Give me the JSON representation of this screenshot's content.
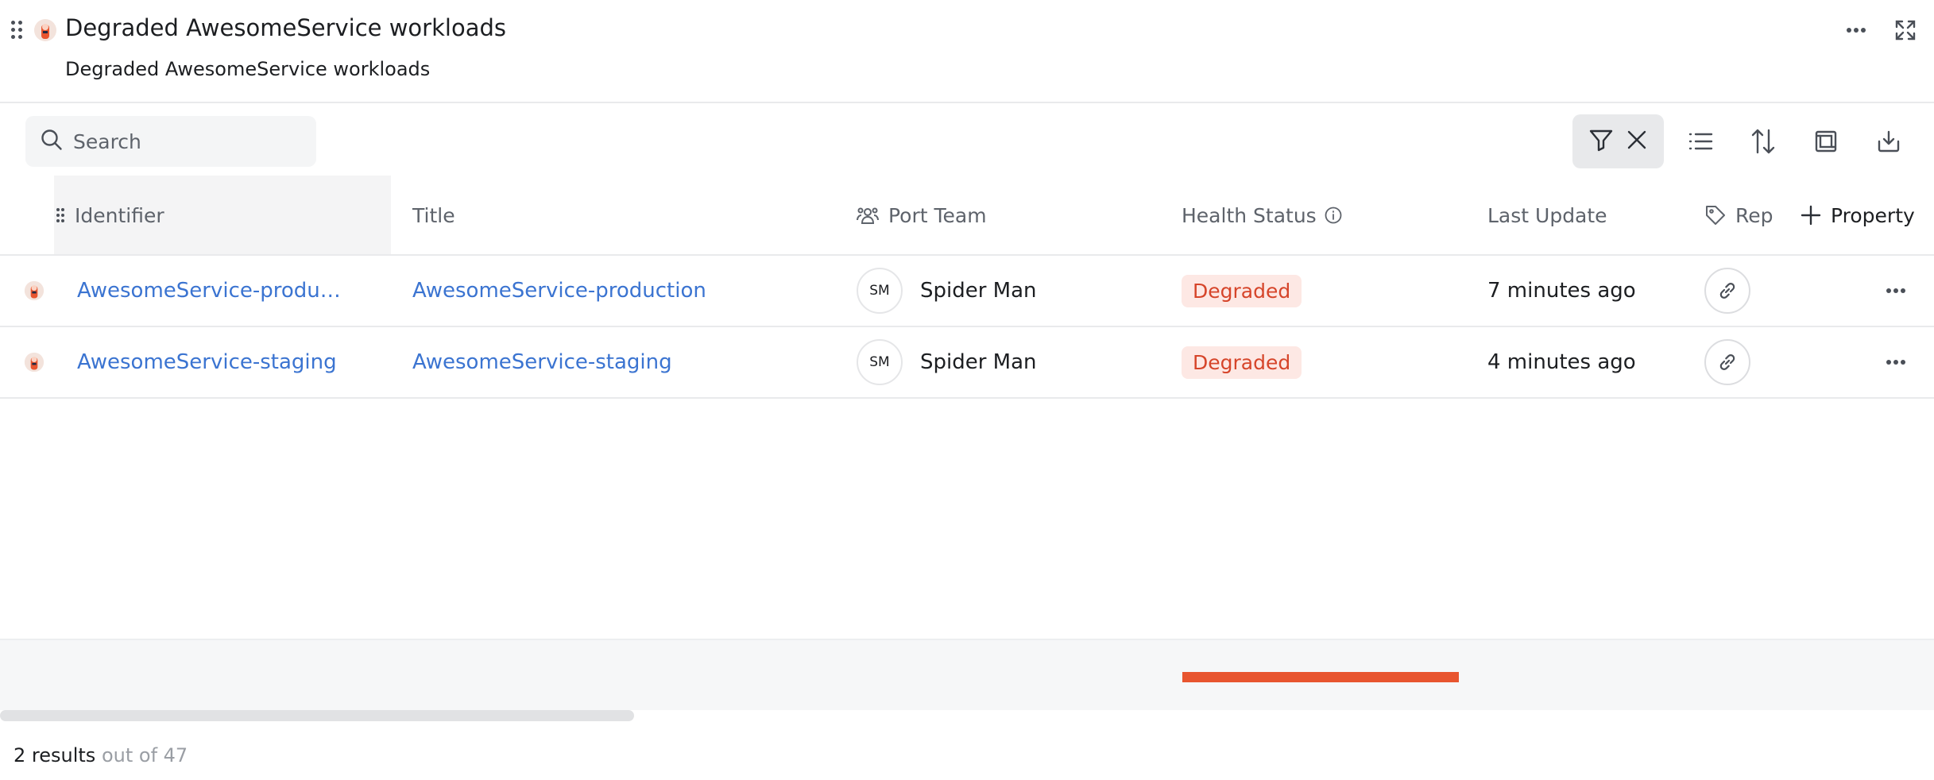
{
  "widget": {
    "title": "Degraded AwesomeService workloads",
    "subtitle": "Degraded AwesomeService workloads"
  },
  "search": {
    "placeholder": "Search"
  },
  "columns": {
    "identifier": "Identifier",
    "title": "Title",
    "team": "Port Team",
    "health": "Health Status",
    "last_update": "Last Update",
    "repo": "Rep",
    "add_property": "Property"
  },
  "rows": [
    {
      "identifier": "AwesomeService-produ…",
      "title": "AwesomeService-production",
      "team_initials": "SM",
      "team_name": "Spider Man",
      "health": "Degraded",
      "last_update": "7 minutes ago"
    },
    {
      "identifier": "AwesomeService-staging",
      "title": "AwesomeService-staging",
      "team_initials": "SM",
      "team_name": "Spider Man",
      "health": "Degraded",
      "last_update": "4 minutes ago"
    }
  ],
  "footer": {
    "results_count": "2 results",
    "results_total": "out of 47"
  },
  "colors": {
    "link": "#3b74d1",
    "degraded_text": "#d6452a",
    "degraded_bg": "#fde8e4",
    "status_bar": "#e8552f"
  },
  "icons": [
    "drag-handle-icon",
    "service-logo-icon",
    "more-icon",
    "expand-icon",
    "search-icon",
    "filter-icon",
    "close-icon",
    "list-icon",
    "sort-icon",
    "layout-icon",
    "download-icon",
    "team-icon",
    "info-icon",
    "tag-icon",
    "plus-icon",
    "link-icon"
  ]
}
